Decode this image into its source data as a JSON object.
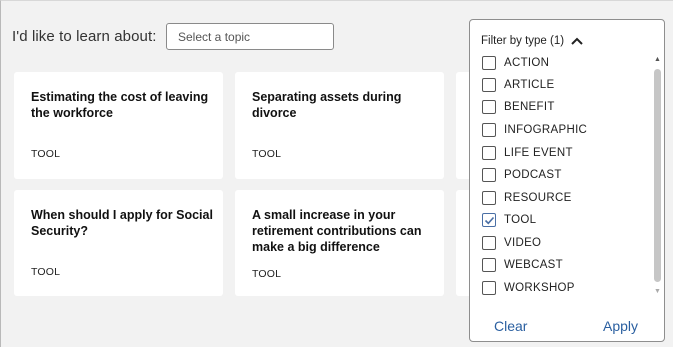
{
  "learn": {
    "label": "I'd like to learn about:",
    "placeholder": "Select a topic"
  },
  "cards": [
    {
      "title": "Estimating the cost of leaving the workforce",
      "type": "TOOL"
    },
    {
      "title": "Separating assets during divorce",
      "type": "TOOL"
    },
    {
      "title": "When should I apply for Social Security?",
      "type": "TOOL"
    },
    {
      "title": "A small increase in your retirement contributions can make a big difference",
      "type": "TOOL"
    }
  ],
  "filter": {
    "header": "Filter by type (1)",
    "options": [
      {
        "label": "ACTION",
        "checked": false
      },
      {
        "label": "ARTICLE",
        "checked": false
      },
      {
        "label": "BENEFIT",
        "checked": false
      },
      {
        "label": "INFOGRAPHIC",
        "checked": false
      },
      {
        "label": "LIFE EVENT",
        "checked": false
      },
      {
        "label": "PODCAST",
        "checked": false
      },
      {
        "label": "RESOURCE",
        "checked": false
      },
      {
        "label": "TOOL",
        "checked": true
      },
      {
        "label": "VIDEO",
        "checked": false
      },
      {
        "label": "WEBCAST",
        "checked": false
      },
      {
        "label": "WORKSHOP",
        "checked": false
      }
    ],
    "clear_label": "Clear",
    "apply_label": "Apply"
  },
  "colors": {
    "accent": "#2a5fa0",
    "background": "#f2f2f2",
    "card": "#ffffff"
  }
}
